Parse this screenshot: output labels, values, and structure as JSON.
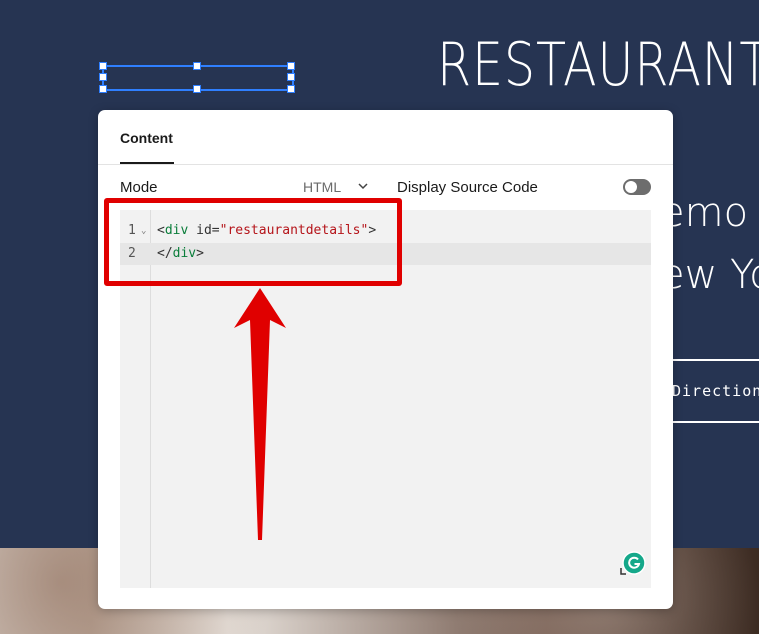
{
  "background": {
    "title": "RESTAURANT",
    "line1": "emo S",
    "line2": "ew Yo",
    "button_label": "Direction"
  },
  "panel": {
    "tab": "Content",
    "mode_label": "Mode",
    "mode_value": "HTML",
    "display_source_label": "Display Source Code",
    "display_source_on": false
  },
  "editor": {
    "lines": [
      {
        "number": "1",
        "open": "<",
        "tag": "div",
        "attr": " id=",
        "value": "\"restaurantdetails\"",
        "close": ">"
      },
      {
        "number": "2",
        "open": "</",
        "tag": "div",
        "close": ">"
      }
    ]
  },
  "colors": {
    "page_bg": "#263452",
    "annotation": "#e00000",
    "selection": "#2f7fff"
  }
}
